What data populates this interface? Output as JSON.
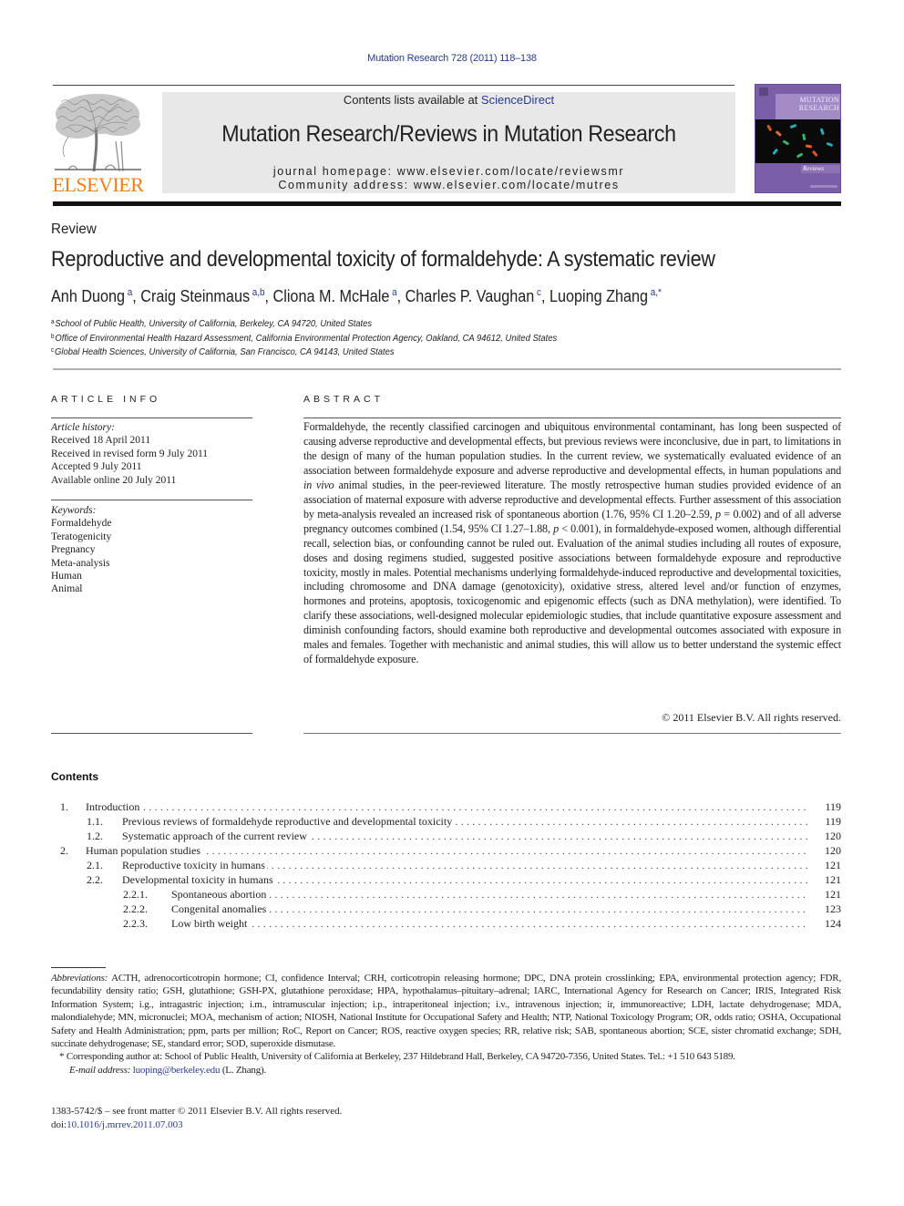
{
  "header": {
    "journal_ref": "Mutation Research 728 (2011) 118–138",
    "contents_prefix": "Contents lists available at ",
    "contents_link": "ScienceDirect",
    "journal_title": "Mutation Research/Reviews in Mutation Research",
    "homepage": "journal homepage: www.elsevier.com/locate/reviewsmr",
    "community": "Community address: www.elsevier.com/locate/mutres",
    "publisher_logo_text": "ELSEVIER",
    "cover": {
      "title_line1": "MUTATION",
      "title_line2": "RESEARCH",
      "subtitle": "Reviews",
      "color": "#7b5ea8"
    }
  },
  "article": {
    "type": "Review",
    "title": "Reproductive and developmental toxicity of formaldehyde: A systematic review",
    "authors": [
      {
        "name": "Anh Duong",
        "sup": "a",
        "sep": ", "
      },
      {
        "name": "Craig Steinmaus",
        "sup": "a,b",
        "sep": ", "
      },
      {
        "name": "Cliona M. McHale",
        "sup": "a",
        "sep": ", "
      },
      {
        "name": "Charles P. Vaughan",
        "sup": "c",
        "sep": ", "
      },
      {
        "name": "Luoping Zhang",
        "sup": "a,*",
        "sep": ""
      }
    ],
    "affiliations": [
      {
        "key": "a",
        "text": "School of Public Health, University of California, Berkeley, CA 94720, United States"
      },
      {
        "key": "b",
        "text": "Office of Environmental Health Hazard Assessment, California Environmental Protection Agency, Oakland, CA 94612, United States"
      },
      {
        "key": "c",
        "text": "Global Health Sciences, University of California, San Francisco, CA 94143, United States"
      }
    ]
  },
  "article_info": {
    "heading": "ARTICLE INFO",
    "history_label": "Article history:",
    "history": [
      "Received 18 April 2011",
      "Received in revised form 9 July 2011",
      "Accepted 9 July 2011",
      "Available online 20 July 2011"
    ],
    "keywords_label": "Keywords:",
    "keywords": [
      "Formaldehyde",
      "Teratogenicity",
      "Pregnancy",
      "Meta-analysis",
      "Human",
      "Animal"
    ]
  },
  "abstract": {
    "heading": "ABSTRACT",
    "part1": "Formaldehyde, the recently classified carcinogen and ubiquitous environmental contaminant, has long been suspected of causing adverse reproductive and developmental effects, but previous reviews were inconclusive, due in part, to limitations in the design of many of the human population studies. In the current review, we systematically evaluated evidence of an association between formaldehyde exposure and adverse reproductive and developmental effects, in human populations and ",
    "italic1": "in vivo",
    "part2": " animal studies, in the peer-reviewed literature. The mostly retrospective human studies provided evidence of an association of maternal exposure with adverse reproductive and developmental effects. Further assessment of this association by meta-analysis revealed an increased risk of spontaneous abortion (1.76, 95% CI 1.20–2.59, ",
    "italic2": "p",
    "part3": " = 0.002) and of all adverse pregnancy outcomes combined (1.54, 95% CI 1.27–1.88, ",
    "italic3": "p",
    "part4": " < 0.001), in formaldehyde-exposed women, although differential recall, selection bias, or confounding cannot be ruled out. Evaluation of the animal studies including all routes of exposure, doses and dosing regimens studied, suggested positive associations between formaldehyde exposure and reproductive toxicity, mostly in males. Potential mechanisms underlying formaldehyde-induced reproductive and developmental toxicities, including chromosome and DNA damage (genotoxicity), oxidative stress, altered level and/or function of enzymes, hormones and proteins, apoptosis, toxicogenomic and epigenomic effects (such as DNA methylation), were identified. To clarify these associations, well-designed molecular epidemiologic studies, that include quantitative exposure assessment and diminish confounding factors, should examine both reproductive and developmental outcomes associated with exposure in males and females. Together with mechanistic and animal studies, this will allow us to better understand the systemic effect of formaldehyde exposure.",
    "copyright": "© 2011 Elsevier B.V. All rights reserved."
  },
  "contents": {
    "heading": "Contents",
    "items": [
      {
        "num": "1.",
        "title": "Introduction",
        "page": "119",
        "level": 0
      },
      {
        "num": "1.1.",
        "title": "Previous reviews of formaldehyde reproductive and developmental toxicity",
        "page": "119",
        "level": 1
      },
      {
        "num": "1.2.",
        "title": "Systematic approach of the current review",
        "page": "120",
        "level": 1
      },
      {
        "num": "2.",
        "title": "Human population studies",
        "page": "120",
        "level": 0
      },
      {
        "num": "2.1.",
        "title": "Reproductive toxicity in humans",
        "page": "121",
        "level": 1
      },
      {
        "num": "2.2.",
        "title": "Developmental toxicity in humans",
        "page": "121",
        "level": 1
      },
      {
        "num": "2.2.1.",
        "title": "Spontaneous abortion",
        "page": "121",
        "level": 2
      },
      {
        "num": "2.2.2.",
        "title": "Congenital anomalies",
        "page": "123",
        "level": 2
      },
      {
        "num": "2.2.3.",
        "title": "Low birth weight",
        "page": "124",
        "level": 2
      }
    ]
  },
  "footnotes": {
    "abbrev_label": "Abbreviations:",
    "abbrev_text": " ACTH, adrenocorticotropin hormone; CI, confidence Interval; CRH, corticotropin releasing hormone; DPC, DNA protein crosslinking; EPA, environmental protection agency; FDR, fecundability density ratio; GSH, glutathione; GSH-PX, glutathione peroxidase; HPA, hypothalamus–pituitary–adrenal; IARC, International Agency for Research on Cancer; IRIS, Integrated Risk Information System; i.g., intragastric injection; i.m., intramuscular injection; i.p., intraperitoneal injection; i.v., intravenous injection; ir, immunoreactive; LDH, lactate dehydrogenase; MDA, malondialehyde; MN, micronuclei; MOA, mechanism of action; NIOSH, National Institute for Occupational Safety and Health; NTP, National Toxicology Program; OR, odds ratio; OSHA, Occupational Safety and Health Administration; ppm, parts per million; RoC, Report on Cancer; ROS, reactive oxygen species; RR, relative risk; SAB, spontaneous abortion; SCE, sister chromatid exchange; SDH, succinate dehydrogenase; SE, standard error; SOD, superoxide dismutase.",
    "corresponding": "* Corresponding author at: School of Public Health, University of California at Berkeley, 237 Hildebrand Hall, Berkeley, CA 94720-7356, United States. Tel.: +1 510 643 5189.",
    "email_label": "E-mail address:",
    "email": "luoping@berkeley.edu",
    "email_suffix": " (L. Zhang)."
  },
  "issn": {
    "line": "1383-5742/$ – see front matter © 2011 Elsevier B.V. All rights reserved.",
    "doi_prefix": "doi:",
    "doi": "10.1016/j.mrrev.2011.07.003"
  },
  "colors": {
    "link": "#2a3a8c",
    "elsevier_orange": "#f07f1a",
    "banner_bg": "#e8e8e8"
  }
}
